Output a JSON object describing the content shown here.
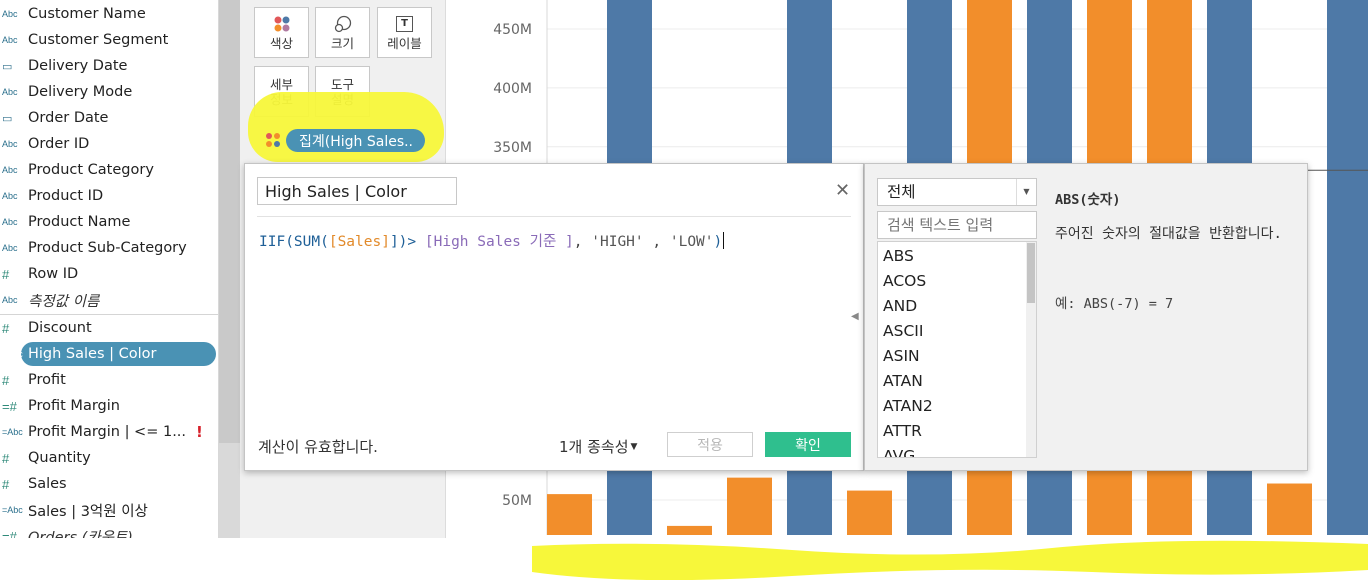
{
  "data_pane": {
    "fields": [
      {
        "type": "Abc",
        "name": "Customer Name"
      },
      {
        "type": "Abc",
        "name": "Customer Segment"
      },
      {
        "type": "date",
        "name": "Delivery Date"
      },
      {
        "type": "Abc",
        "name": "Delivery Mode"
      },
      {
        "type": "date",
        "name": "Order Date"
      },
      {
        "type": "Abc",
        "name": "Order ID"
      },
      {
        "type": "Abc",
        "name": "Product Category"
      },
      {
        "type": "Abc",
        "name": "Product ID"
      },
      {
        "type": "Abc",
        "name": "Product Name"
      },
      {
        "type": "Abc",
        "name": "Product Sub-Category"
      },
      {
        "type": "#",
        "name": "Row ID"
      },
      {
        "type": "Abc",
        "name": "측정값 이름"
      },
      {
        "type": "#",
        "name": "Discount"
      },
      {
        "type": "=Abc",
        "name": "High Sales | Color"
      },
      {
        "type": "#",
        "name": "Profit"
      },
      {
        "type": "=#",
        "name": "Profit Margin"
      },
      {
        "type": "=Abc",
        "name": "Profit Margin | <= 1..."
      },
      {
        "type": "#",
        "name": "Quantity"
      },
      {
        "type": "#",
        "name": "Sales"
      },
      {
        "type": "=Abc",
        "name": "Sales | 3억원 이상"
      },
      {
        "type": "=#",
        "name": "Orders (카운트)"
      }
    ],
    "warning_glyph": "!"
  },
  "marks_card": {
    "color_label": "색상",
    "size_label": "크기",
    "label_label": "레이블",
    "detail_label": "세부\n정보",
    "tooltip_label": "도구\n설명",
    "label_icon_glyph": "T",
    "color_pill": "집계(High Sales.."
  },
  "chart_data": {
    "type": "bar",
    "y_ticks": [
      "450M",
      "400M",
      "350M",
      "50M"
    ],
    "y_tick_values": [
      450,
      400,
      350,
      50
    ],
    "unit": "M",
    "visible_ylim": [
      25,
      475
    ],
    "series_colors": {
      "HIGH": "#4e79a7",
      "LOW": "#f28e2b"
    },
    "bars": [
      {
        "value": 55,
        "group": "LOW"
      },
      {
        "value": 480,
        "group": "HIGH"
      },
      {
        "value": 28,
        "group": "LOW"
      },
      {
        "value": 69,
        "group": "LOW"
      },
      {
        "value": 480,
        "group": "HIGH"
      },
      {
        "value": 58,
        "group": "LOW"
      },
      {
        "value": 480,
        "group": "HIGH"
      },
      {
        "value": 480,
        "group": "LOW"
      },
      {
        "value": 480,
        "group": "HIGH"
      },
      {
        "value": 480,
        "group": "LOW"
      },
      {
        "value": 480,
        "group": "LOW"
      },
      {
        "value": 480,
        "group": "HIGH"
      },
      {
        "value": 64,
        "group": "LOW"
      },
      {
        "value": 480,
        "group": "HIGH"
      }
    ],
    "reference_line_value": 330
  },
  "calc_editor": {
    "name": "High Sales | Color",
    "close_glyph": "✕",
    "formula": {
      "fn1": "IIF(SUM(",
      "field": "[Sales]",
      "mid": "])>",
      "param": " [High Sales 기준 ]",
      "sep1": ", ",
      "str1": "'HIGH'",
      "sep2": " , ",
      "str2": "'LOW'",
      "end": ")"
    },
    "status": "계산이 유효합니다.",
    "dependencies": "1개 종속성",
    "apply_label": "적용",
    "ok_label": "확인"
  },
  "function_panel": {
    "category": "전체",
    "search_placeholder": "검색 텍스트 입력",
    "functions": [
      "ABS",
      "ACOS",
      "AND",
      "ASCII",
      "ASIN",
      "ATAN",
      "ATAN2",
      "ATTR",
      "AVG"
    ],
    "selected_title": "ABS(숫자)",
    "description": "주어진 숫자의 절대값을 반환합니다.",
    "example": "예: ABS(-7) = 7"
  }
}
